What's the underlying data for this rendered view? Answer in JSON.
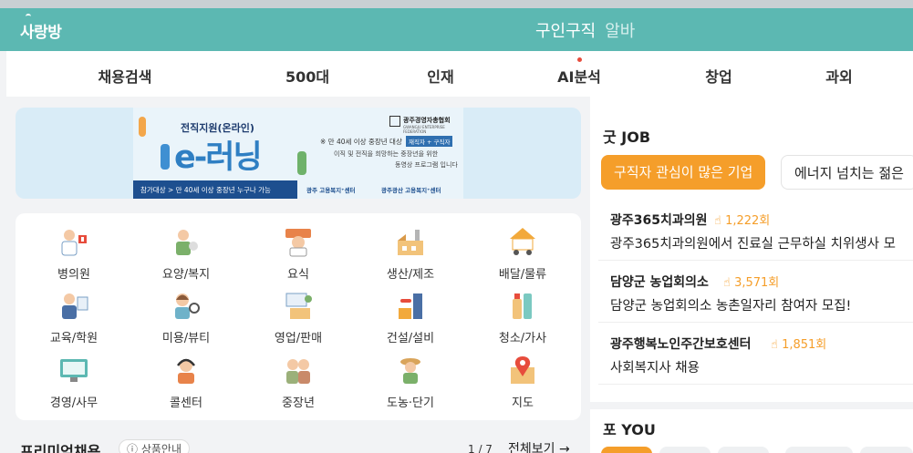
{
  "header": {
    "logo": "사랑방",
    "tabs": [
      {
        "label": "구인구직",
        "active": true
      },
      {
        "label": "알바",
        "active": false
      }
    ],
    "bg_color": "#5cb8b2"
  },
  "nav": {
    "items": [
      {
        "label": "채용검색"
      },
      {
        "label": "500대"
      },
      {
        "label": "인재"
      },
      {
        "label": "AI분석",
        "has_dot": true
      },
      {
        "label": "창업"
      },
      {
        "label": "과외"
      }
    ]
  },
  "banner": {
    "title": "전직지원(온라인)",
    "org": "광주경영자총협회",
    "org_sub": "GWANGJU ENTERPRISE FEDERATION",
    "elearning": "e-러닝",
    "desc1": "※ 만 40세 이상 중장년 대상",
    "tag": "재직자 + 구직자",
    "desc2": "이직 및 전직을 희망하는 중장년을 위한",
    "desc3": "동영상 프로그램 입니다",
    "target": "참가대상 > 만 40세 이상 중장년 누구나 가능",
    "center1": "광주 고용복지⁺센터",
    "center2": "광주광산 고용복지⁺센터"
  },
  "categories": [
    {
      "label": "병의원",
      "icon": "doctor-icon"
    },
    {
      "label": "요양/복지",
      "icon": "caregiver-icon"
    },
    {
      "label": "요식",
      "icon": "chef-icon"
    },
    {
      "label": "생산/제조",
      "icon": "factory-icon"
    },
    {
      "label": "배달/물류",
      "icon": "delivery-icon"
    },
    {
      "label": "교육/학원",
      "icon": "teacher-icon"
    },
    {
      "label": "미용/뷰티",
      "icon": "beauty-icon"
    },
    {
      "label": "영업/판매",
      "icon": "sales-icon"
    },
    {
      "label": "건설/설비",
      "icon": "construction-icon"
    },
    {
      "label": "청소/가사",
      "icon": "cleaning-icon"
    },
    {
      "label": "경영/사무",
      "icon": "office-icon"
    },
    {
      "label": "콜센터",
      "icon": "callcenter-icon"
    },
    {
      "label": "중장년",
      "icon": "senior-icon"
    },
    {
      "label": "도농·단기",
      "icon": "farmer-icon"
    },
    {
      "label": "지도",
      "icon": "map-pin-icon"
    }
  ],
  "premium": {
    "title": "프리미엄채용",
    "info": "상품안내",
    "pager": "1 / 7",
    "view_all": "전체보기 →"
  },
  "good_job": {
    "title": "굿 JOB",
    "chips": [
      {
        "label": "구직자 관심이 많은 기업",
        "active": true
      },
      {
        "label": "에너지 넘치는 젊은",
        "active": false
      }
    ],
    "jobs": [
      {
        "company": "광주365치과의원",
        "views": "1,222회",
        "title": "광주365치과의원에서 진료실 근무하실 치위생사 모"
      },
      {
        "company": "담양군 농업회의소",
        "views": "3,571회",
        "title": "담양군 농업회의소 농촌일자리 참여자 모집!"
      },
      {
        "company": "광주행복노인주간보호센터",
        "views": "1,851회",
        "title": "사회복지사 채용"
      }
    ],
    "accent_color": "#f59e2a"
  },
  "for_you": {
    "title": "포 YOU"
  }
}
